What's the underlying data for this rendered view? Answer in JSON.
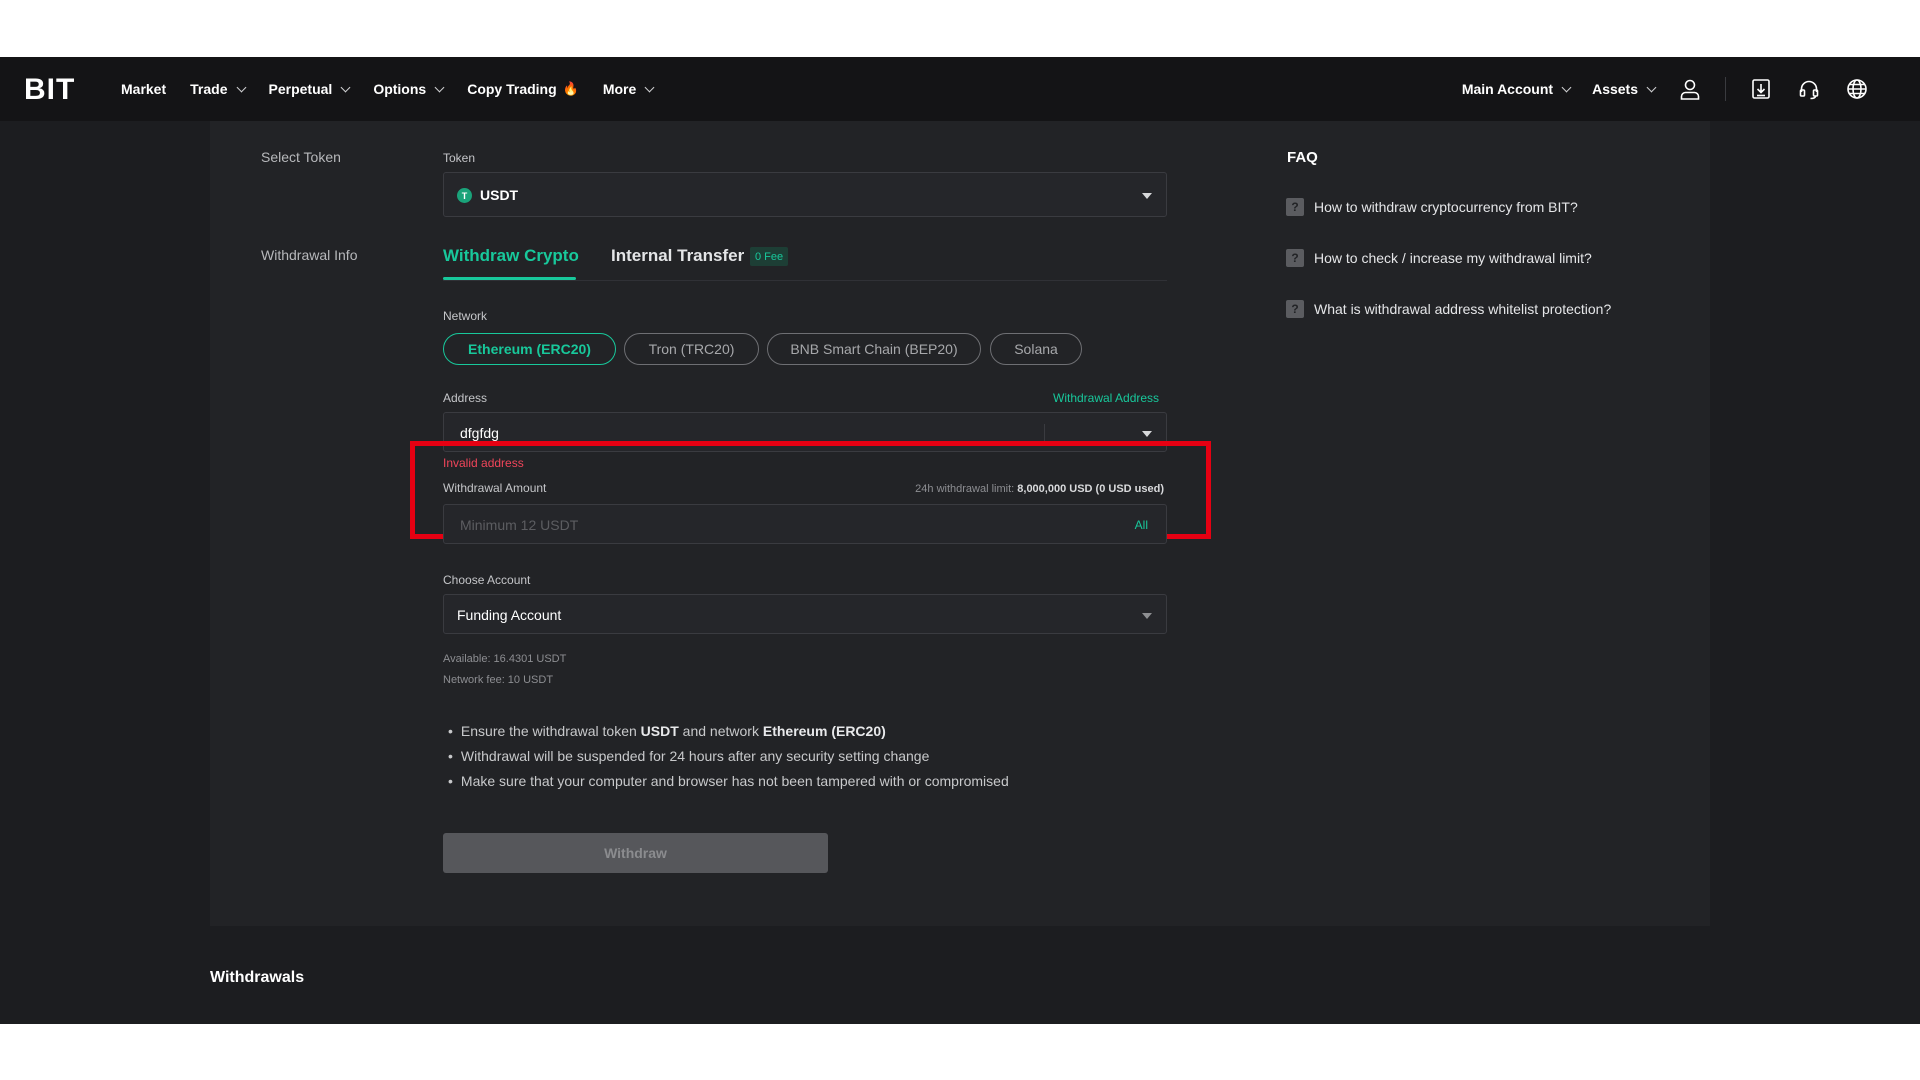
{
  "nav": {
    "logo": "BIT",
    "items": [
      {
        "label": "Market",
        "dropdown": false
      },
      {
        "label": "Trade",
        "dropdown": true
      },
      {
        "label": "Perpetual",
        "dropdown": true
      },
      {
        "label": "Options",
        "dropdown": true
      },
      {
        "label": "Copy Trading",
        "dropdown": false
      },
      {
        "label": "More",
        "dropdown": true
      }
    ],
    "fire_icon": "🔥",
    "main_account": "Main Account",
    "assets": "Assets"
  },
  "form": {
    "select_token_label": "Select Token",
    "token_field_label": "Token",
    "token_value": "USDT",
    "token_icon_glyph": "T",
    "withdrawal_info_label": "Withdrawal Info",
    "tab_withdraw": "Withdraw Crypto",
    "tab_internal": "Internal Transfer",
    "fee_badge": "0 Fee",
    "network_label": "Network",
    "networks": [
      "Ethereum (ERC20)",
      "Tron (TRC20)",
      "BNB Smart Chain (BEP20)",
      "Solana"
    ],
    "address_label": "Address",
    "withdrawal_address_link": "Withdrawal Address",
    "address_value": "dfgfdg",
    "address_error": "Invalid address",
    "amount_label": "Withdrawal Amount",
    "limit_prefix": "24h withdrawal limit: ",
    "limit_value": "8,000,000 USD (0 USD used)",
    "amount_placeholder": "Minimum 12 USDT",
    "all_label": "All",
    "choose_account_label": "Choose Account",
    "account_value": "Funding Account",
    "available": "Available:  16.4301 USDT",
    "network_fee": "Network fee:  10 USDT",
    "notes": {
      "n1_a": "Ensure the withdrawal token ",
      "n1_b": "USDT",
      "n1_c": " and network ",
      "n1_d": "Ethereum (ERC20)",
      "n2": "Withdrawal will be suspended for 24 hours after any security setting change",
      "n3": "Make sure that your computer and browser has not been tampered with or compromised"
    },
    "withdraw_button": "Withdraw"
  },
  "faq": {
    "title": "FAQ",
    "items": [
      "How to withdraw cryptocurrency from BIT?",
      "How to check / increase my withdrawal limit?",
      "What is withdrawal address whitelist protection?"
    ]
  },
  "withdrawals_heading": "Withdrawals",
  "colors": {
    "accent": "#18c89b",
    "error": "#f0455a",
    "highlight": "#e60012"
  }
}
